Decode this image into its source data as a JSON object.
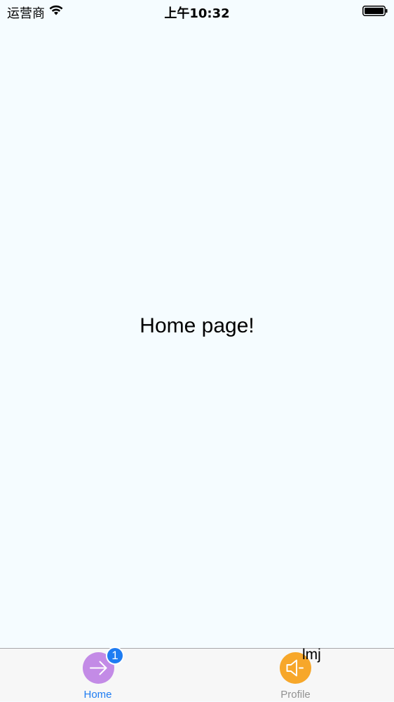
{
  "status_bar": {
    "carrier": "运营商",
    "time": "上午10:32",
    "wifi_icon": "wifi-icon",
    "battery_icon": "battery-icon",
    "battery_level": 1.0
  },
  "main": {
    "message": "Home page!",
    "background_color": "#F5FCFF"
  },
  "tab_bar": {
    "tabs": [
      {
        "label": "Home",
        "icon": "arrow-right-icon",
        "icon_color": "#C38BE6",
        "badge": "1",
        "selected": true
      },
      {
        "label": "Profile",
        "icon": "speaker-icon",
        "icon_color": "#F7A72A",
        "badge": "lmj",
        "selected": false
      }
    ],
    "active_color": "#1E7CF2",
    "inactive_color": "#929292"
  }
}
